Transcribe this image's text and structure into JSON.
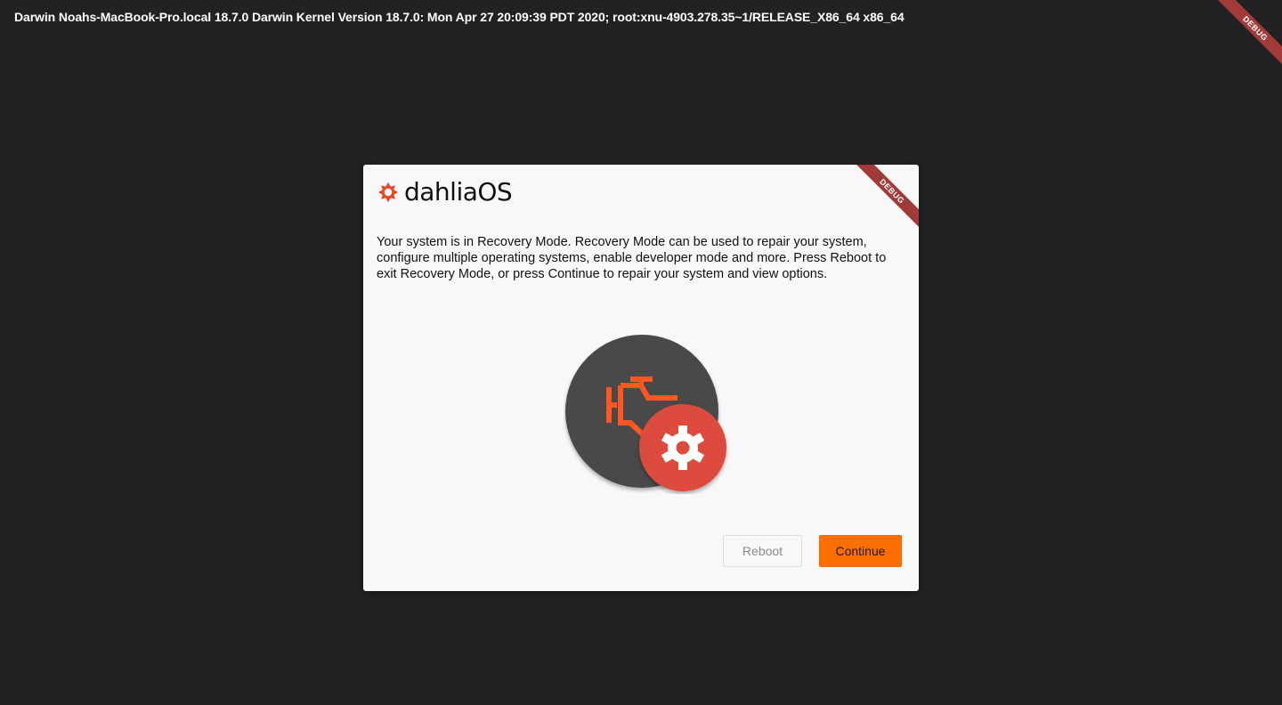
{
  "system_info": "Darwin Noahs-MacBook-Pro.local 18.7.0 Darwin Kernel Version 18.7.0: Mon Apr 27 20:09:39 PDT 2020; root:xnu-4903.278.35~1/RELEASE_X86_64 x86_64",
  "debug_banner": "DEBUG",
  "dialog": {
    "brand_name": "dahliaOS",
    "brand_logo_icon": "dahlia-flower-icon",
    "message": "Your system is in Recovery Mode. Recovery Mode can be used to repair your system, configure multiple operating systems, enable developer mode and more. Press Reboot to exit Recovery Mode, or press Continue to repair your system and view options.",
    "illustration_icons": [
      "engine-check-icon",
      "settings-gear-icon"
    ],
    "buttons": {
      "reboot": "Reboot",
      "continue": "Continue"
    }
  },
  "colors": {
    "background": "#222222",
    "dialog_background": "#f8f8f8",
    "accent_orange": "#ff6f00",
    "brand_red": "#e8472a",
    "engine_orange": "#ff5722",
    "gear_badge_red": "#dc4b3e",
    "illustration_circle": "#4a4a4a",
    "debug_ribbon": "#a23a3a"
  }
}
